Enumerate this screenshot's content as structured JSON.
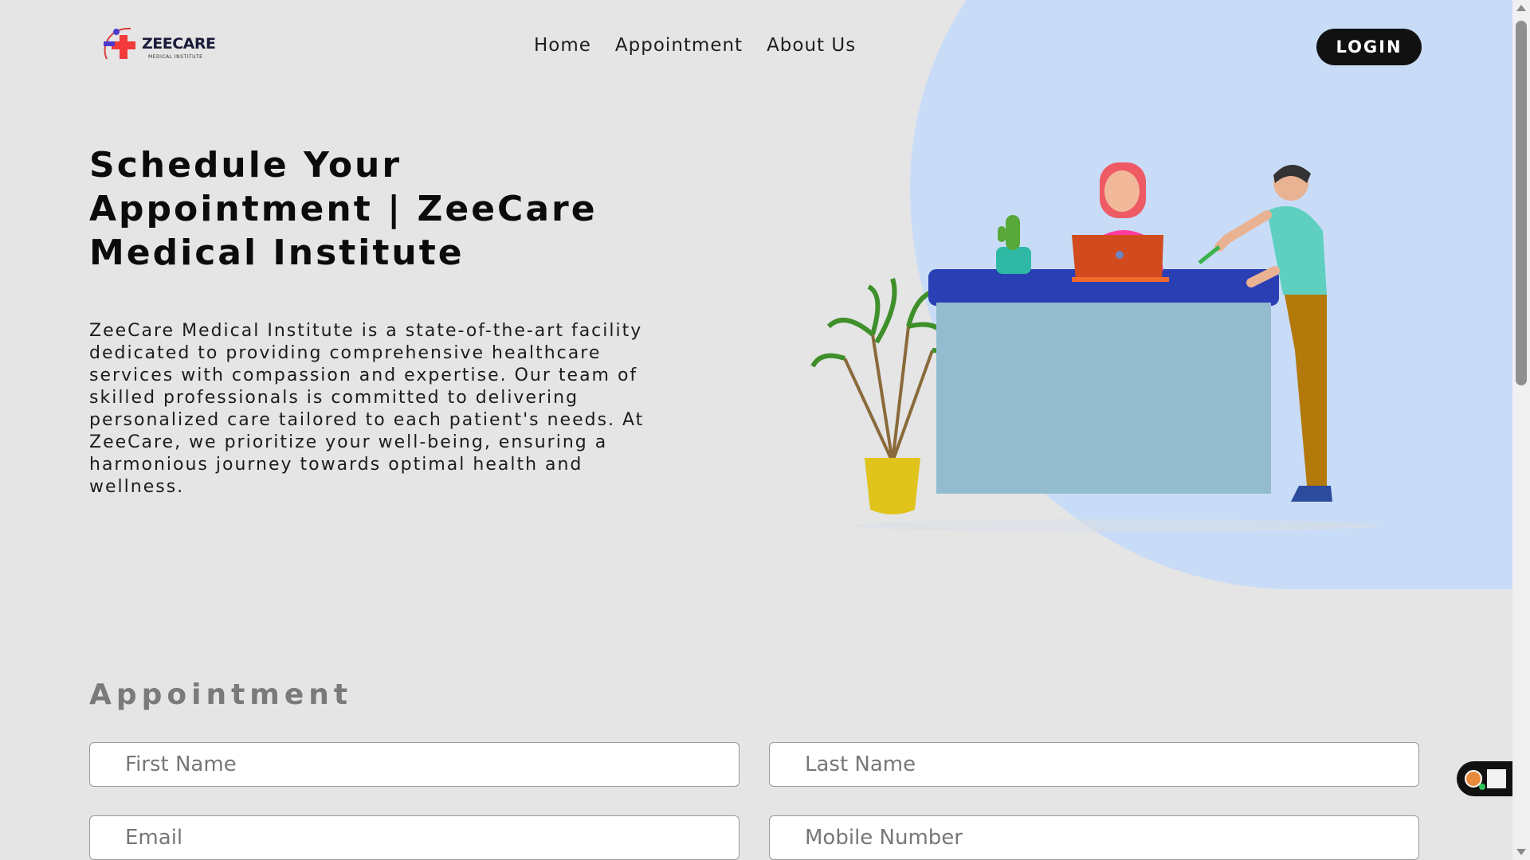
{
  "brand": {
    "name": "ZEECARE",
    "subtitle": "MEDICAL INSTITUTE"
  },
  "nav": {
    "items": [
      "Home",
      "Appointment",
      "About Us"
    ],
    "login_label": "LOGIN"
  },
  "hero": {
    "title": "Schedule Your Appointment | ZeeCare Medical Institute",
    "description": "ZeeCare Medical Institute is a state-of-the-art facility dedicated to providing comprehensive healthcare services with compassion and expertise. Our team of skilled professionals is committed to delivering personalized care tailored to each patient's needs. At ZeeCare, we prioritize your well-being, ensuring a harmonious journey towards optimal health and wellness."
  },
  "appointment": {
    "heading": "Appointment",
    "fields": {
      "first_name": {
        "placeholder": "First Name",
        "value": ""
      },
      "last_name": {
        "placeholder": "Last Name",
        "value": ""
      },
      "email": {
        "placeholder": "Email",
        "value": ""
      },
      "mobile": {
        "placeholder": "Mobile Number",
        "value": ""
      }
    }
  },
  "colors": {
    "accent_blob": "#c9dcf7",
    "background": "#e5e5e5",
    "button": "#111111"
  },
  "icons": {
    "logo": "medical-cross-logo",
    "widget": "floating-assistant-widget"
  }
}
